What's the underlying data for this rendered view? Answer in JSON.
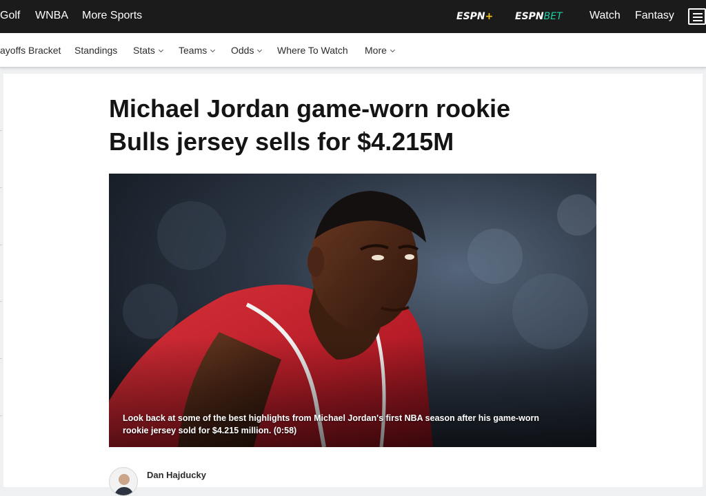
{
  "topnav": {
    "items": [
      "Golf",
      "WNBA",
      "More Sports"
    ],
    "espn_plus": {
      "text": "ESPN",
      "suffix": "+"
    },
    "espn_bet": {
      "text": "ESPN",
      "suffix": "BET"
    },
    "right_items": [
      "Watch",
      "Fantasy"
    ]
  },
  "subnav": {
    "items": [
      {
        "label": "ayoffs Bracket",
        "dropdown": false
      },
      {
        "label": "Standings",
        "dropdown": false
      },
      {
        "label": "Stats",
        "dropdown": true
      },
      {
        "label": "Teams",
        "dropdown": true
      },
      {
        "label": "Odds",
        "dropdown": true
      },
      {
        "label": "Where To Watch",
        "dropdown": false
      },
      {
        "label": "More",
        "dropdown": true
      }
    ]
  },
  "article": {
    "headline_line1": "Michael Jordan game-worn rookie",
    "headline_line2": "Bulls jersey sells for $4.215M",
    "caption": "Look back at some of the best highlights from Michael Jordan's first NBA season after his game-worn rookie jersey sold for $4.215 million. (0:58)",
    "author": "Dan Hajducky"
  },
  "colors": {
    "topnav_bg": "#1b1b1b",
    "espn_plus_accent": "#f5c518",
    "espn_bet_accent": "#1bd1a5",
    "jersey_red": "#c8202c"
  }
}
